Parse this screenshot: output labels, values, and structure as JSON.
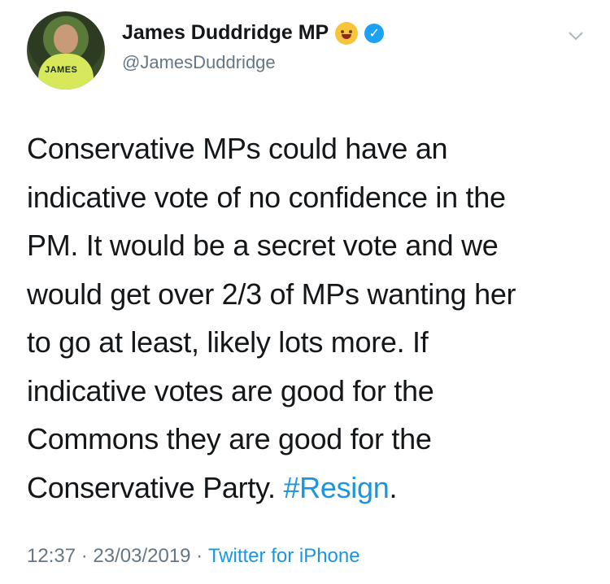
{
  "author": {
    "display_name": "James Duddridge MP",
    "handle": "@JamesDuddridge",
    "avatar_text": "JAMES",
    "emoji_icon": "hugging-face-icon",
    "verified_icon": "verified-badge-icon"
  },
  "tweet": {
    "lines": [
      "Conservative MPs could have an",
      "indicative vote of no confidence in the",
      "PM. It would be a secret vote and we",
      "would get over 2/3 of MPs wanting her",
      "to go at least, likely lots more. If",
      "indicative votes are good for the",
      "Commons they are good for the",
      "Conservative Party. "
    ],
    "hashtag": "#Resign",
    "trailing": "."
  },
  "meta": {
    "time": "12:37",
    "sep1": " · ",
    "date": "23/03/2019",
    "sep2": " · ",
    "source": "Twitter for iPhone"
  },
  "colors": {
    "link": "#1b95e0",
    "verified": "#1da1f2",
    "secondary_text": "#657786"
  }
}
